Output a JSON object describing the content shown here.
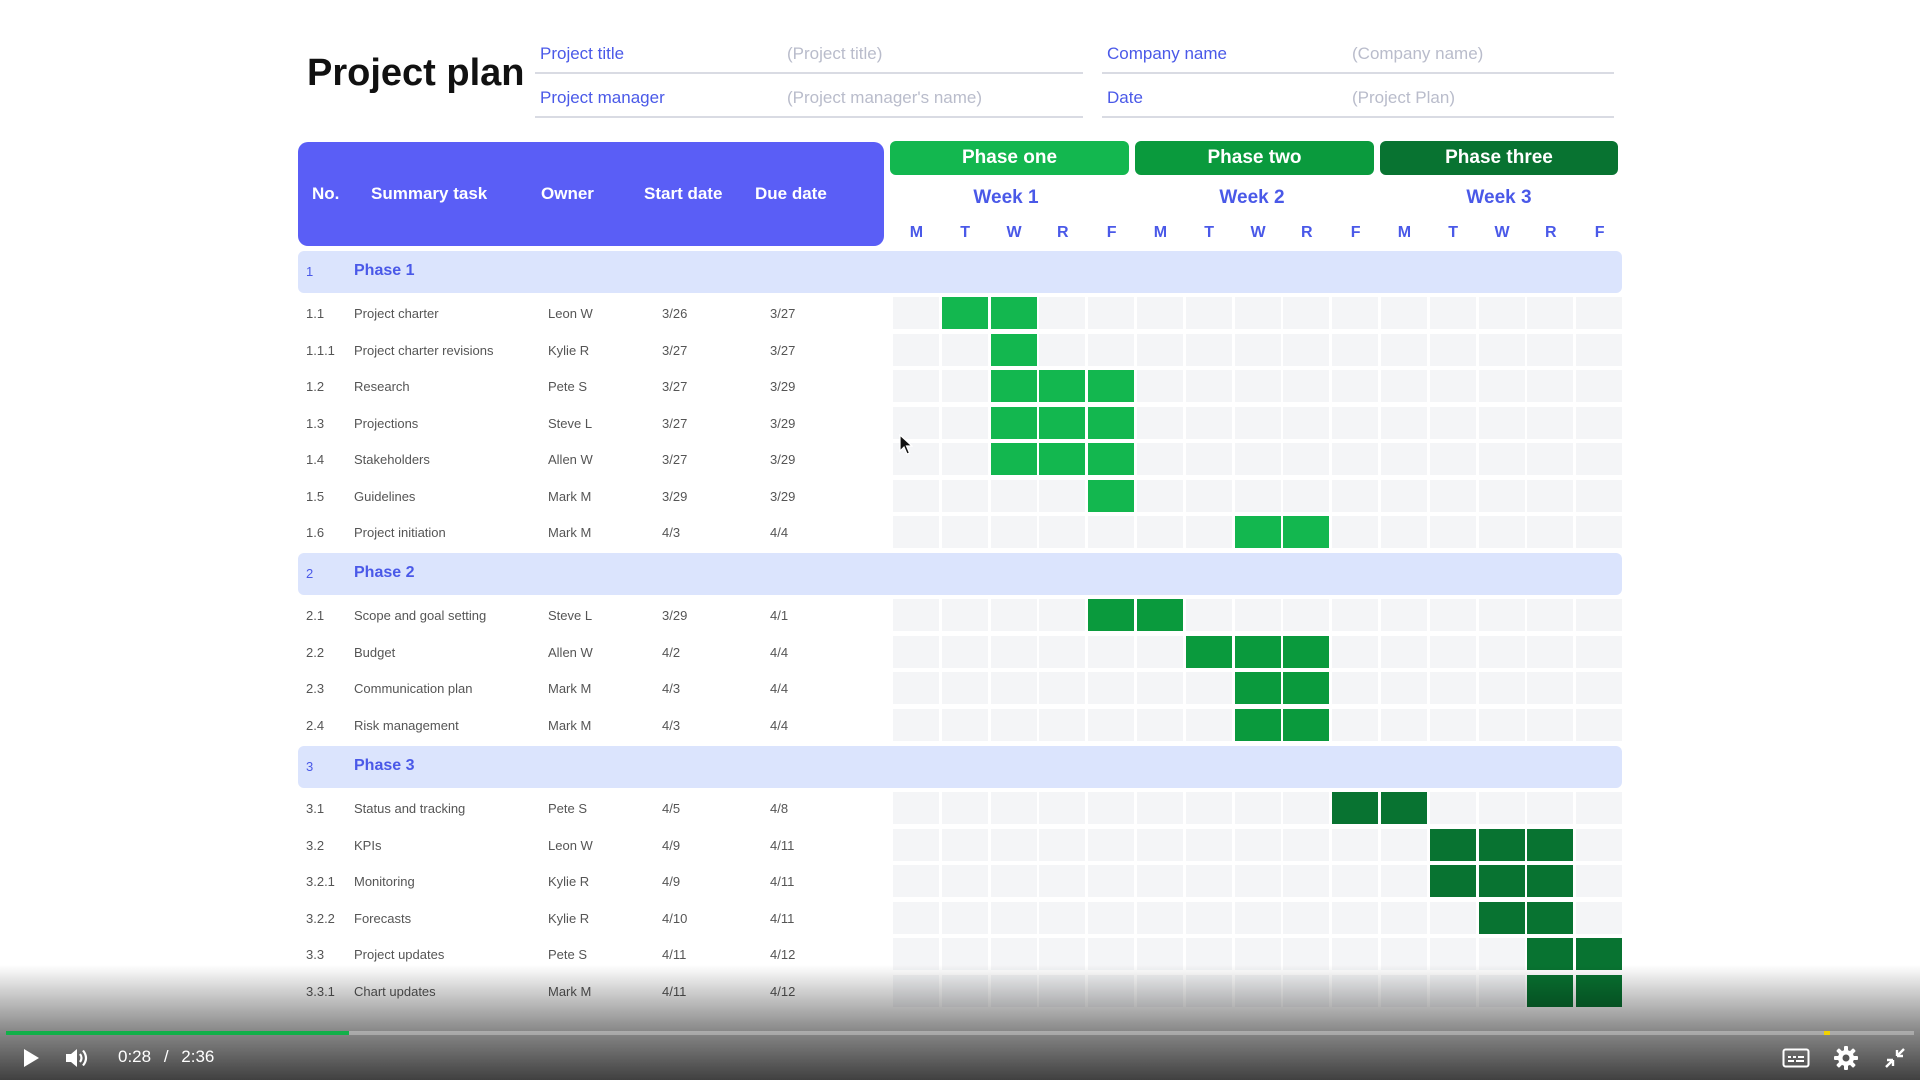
{
  "header": {
    "title": "Project plan",
    "fields": [
      {
        "label": "Project title",
        "value": "(Project title)"
      },
      {
        "label": "Project manager",
        "value": "(Project manager's name)"
      },
      {
        "label": "Company name",
        "value": "(Company name)"
      },
      {
        "label": "Date",
        "value": "(Project Plan)"
      }
    ]
  },
  "columns": {
    "no": "No.",
    "summary": "Summary task",
    "owner": "Owner",
    "start": "Start date",
    "due": "Due date"
  },
  "phases_header": [
    {
      "label": "Phase one",
      "color": "#13b74f"
    },
    {
      "label": "Phase two",
      "color": "#0a9a3d"
    },
    {
      "label": "Phase three",
      "color": "#087331"
    }
  ],
  "weeks": [
    "Week 1",
    "Week 2",
    "Week 3"
  ],
  "days": [
    "M",
    "T",
    "W",
    "R",
    "F"
  ],
  "colors": {
    "accent": "#5a5ef6",
    "phase_row_bg": "#dbe4fd",
    "bar_phase1": "#13b74f",
    "bar_phase2": "#0a9a3d",
    "bar_phase3": "#087331"
  },
  "sections": [
    {
      "num": "1",
      "name": "Phase 1",
      "tasks": [
        {
          "no": "1.1",
          "task": "Project charter",
          "owner": "Leon W",
          "start": "3/26",
          "due": "3/27",
          "day_start": 2,
          "day_end": 3
        },
        {
          "no": "1.1.1",
          "task": "Project charter revisions",
          "owner": "Kylie R",
          "start": "3/27",
          "due": "3/27",
          "day_start": 3,
          "day_end": 3
        },
        {
          "no": "1.2",
          "task": "Research",
          "owner": "Pete S",
          "start": "3/27",
          "due": "3/29",
          "day_start": 3,
          "day_end": 5
        },
        {
          "no": "1.3",
          "task": "Projections",
          "owner": "Steve L",
          "start": "3/27",
          "due": "3/29",
          "day_start": 3,
          "day_end": 5
        },
        {
          "no": "1.4",
          "task": "Stakeholders",
          "owner": "Allen W",
          "start": "3/27",
          "due": "3/29",
          "day_start": 3,
          "day_end": 5
        },
        {
          "no": "1.5",
          "task": "Guidelines",
          "owner": "Mark M",
          "start": "3/29",
          "due": "3/29",
          "day_start": 5,
          "day_end": 5
        },
        {
          "no": "1.6",
          "task": "Project initiation",
          "owner": "Mark M",
          "start": "4/3",
          "due": "4/4",
          "day_start": 8,
          "day_end": 9
        }
      ]
    },
    {
      "num": "2",
      "name": "Phase 2",
      "tasks": [
        {
          "no": "2.1",
          "task": "Scope and goal setting",
          "owner": "Steve L",
          "start": "3/29",
          "due": "4/1",
          "day_start": 5,
          "day_end": 6
        },
        {
          "no": "2.2",
          "task": "Budget",
          "owner": "Allen W",
          "start": "4/2",
          "due": "4/4",
          "day_start": 7,
          "day_end": 9
        },
        {
          "no": "2.3",
          "task": "Communication plan",
          "owner": "Mark M",
          "start": "4/3",
          "due": "4/4",
          "day_start": 8,
          "day_end": 9
        },
        {
          "no": "2.4",
          "task": "Risk management",
          "owner": "Mark M",
          "start": "4/3",
          "due": "4/4",
          "day_start": 8,
          "day_end": 9
        }
      ]
    },
    {
      "num": "3",
      "name": "Phase 3",
      "tasks": [
        {
          "no": "3.1",
          "task": "Status and tracking",
          "owner": "Pete S",
          "start": "4/5",
          "due": "4/8",
          "day_start": 10,
          "day_end": 11
        },
        {
          "no": "3.2",
          "task": "KPIs",
          "owner": "Leon W",
          "start": "4/9",
          "due": "4/11",
          "day_start": 12,
          "day_end": 14
        },
        {
          "no": "3.2.1",
          "task": "Monitoring",
          "owner": "Kylie R",
          "start": "4/9",
          "due": "4/11",
          "day_start": 12,
          "day_end": 14
        },
        {
          "no": "3.2.2",
          "task": "Forecasts",
          "owner": "Kylie R",
          "start": "4/10",
          "due": "4/11",
          "day_start": 13,
          "day_end": 14
        },
        {
          "no": "3.3",
          "task": "Project updates",
          "owner": "Pete S",
          "start": "4/11",
          "due": "4/12",
          "day_start": 14,
          "day_end": 15
        },
        {
          "no": "3.3.1",
          "task": "Chart updates",
          "owner": "Mark M",
          "start": "4/11",
          "due": "4/12",
          "day_start": 14,
          "day_end": 15
        }
      ]
    }
  ],
  "player": {
    "current_time": "0:28",
    "separator": "/",
    "duration": "2:36",
    "progress": 0.18,
    "icons": [
      "play-icon",
      "volume-icon",
      "captions-icon",
      "settings-icon",
      "exit-fullscreen-icon"
    ]
  }
}
